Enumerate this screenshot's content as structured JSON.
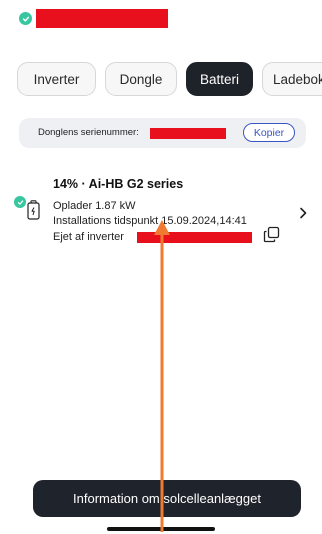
{
  "tabs": [
    {
      "label": "Inverter"
    },
    {
      "label": "Dongle"
    },
    {
      "label": "Batteri"
    },
    {
      "label": "Ladebok"
    }
  ],
  "active_tab": "Batteri",
  "serial": {
    "label": "Donglens serienummer:",
    "copy_label": "Kopier"
  },
  "device": {
    "title": "14% · Ai-HB G2 series",
    "charge": "Oplader 1.87 kW",
    "install": "Installations tidspunkt 15.09.2024,14:41",
    "owner": "Ejet af inverter"
  },
  "bottom_button": "Information om solcelleanlægget",
  "colors": {
    "accent_blue": "#3a56c4",
    "status_green": "#37c6a0",
    "redaction_red": "#e8101c",
    "annotation_orange": "#f07a30",
    "dark": "#1f232b"
  },
  "icons": [
    "check-icon",
    "battery-icon",
    "copy-icon",
    "chevron-right-icon"
  ]
}
